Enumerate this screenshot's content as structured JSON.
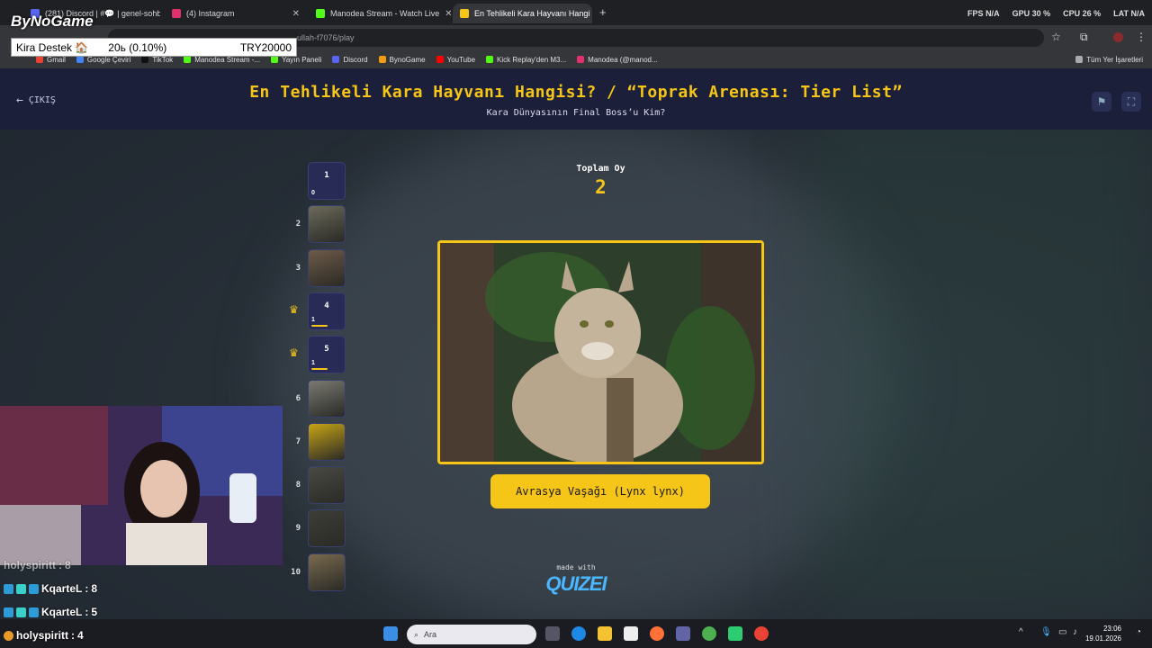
{
  "browser": {
    "tabs": [
      {
        "label": "(281) Discord | #💬 | genel-sohb",
        "color": "#5865f2"
      },
      {
        "label": "(4) Instagram",
        "color": "#e1306c"
      },
      {
        "label": "Manodea Stream - Watch Live",
        "color": "#53fc18"
      },
      {
        "label": "En Tehlikeli Kara Hayvanı Hangi",
        "color": "#f5c518"
      }
    ],
    "url": "ullah-f7076/play",
    "bookmarks": [
      "Gmail",
      "Google Çeviri",
      "TikTok",
      "Manodea Stream -...",
      "Yayın Paneli",
      "Discord",
      "BynoGame",
      "YouTube",
      "Kick Replay'den M3...",
      "Manodea (@manod..."
    ],
    "all_bookmarks": "Tüm Yer İşaretleri"
  },
  "overlay": {
    "brand": "ByNoGame",
    "kira_label": "Kira Destek 🏠",
    "kira_amount": "20ь (0.10%)",
    "kira_goal": "TRY20000",
    "perf": {
      "fps_label": "FPS",
      "fps": "N/A",
      "gpu_label": "GPU",
      "gpu": "30 %",
      "cpu_label": "CPU",
      "cpu": "26 %",
      "lat_label": "LAT",
      "lat": "N/A"
    },
    "chat": [
      {
        "user": "holyspiritt",
        "score": "8"
      },
      {
        "user": "KqarteL",
        "score": "8"
      },
      {
        "user": "KqarteL",
        "score": "5"
      },
      {
        "user": "holyspiritt",
        "score": "4"
      }
    ]
  },
  "quiz": {
    "exit_label": "ÇIKIŞ",
    "title": "En Tehlikeli Kara Hayvanı Hangisi? / “Toprak Arenası: Tier List”",
    "subtitle": "Kara Dünyasının Final Boss’u Kim?",
    "total_label": "Toplam Oy",
    "total_value": "2",
    "answer": "Avrasya Vaşağı (Lynx lynx)",
    "made_with": "made with",
    "quizei": "QUIZEI",
    "ranks": [
      {
        "num": "1",
        "label": "1",
        "votes": "0",
        "type": "empty",
        "bar": 0
      },
      {
        "num": "2",
        "type": "image",
        "color": "#6b6a5a"
      },
      {
        "num": "3",
        "type": "image",
        "color": "#6e5a48"
      },
      {
        "num": "4",
        "label": "4",
        "votes": "1",
        "type": "empty",
        "crown": true,
        "bar": 0.5
      },
      {
        "num": "5",
        "label": "5",
        "votes": "1",
        "type": "empty",
        "crown": true,
        "bar": 0.5
      },
      {
        "num": "6",
        "type": "image",
        "color": "#7a7a72"
      },
      {
        "num": "7",
        "type": "image",
        "color": "#c8a514"
      },
      {
        "num": "8",
        "type": "image",
        "color": "#4a4a44"
      },
      {
        "num": "9",
        "type": "image",
        "color": "#3e3e38"
      },
      {
        "num": "10",
        "type": "image",
        "color": "#7a6a4e"
      }
    ]
  },
  "taskbar": {
    "search_placeholder": "Ara",
    "time": "23:06",
    "date": "19.01.2026"
  }
}
